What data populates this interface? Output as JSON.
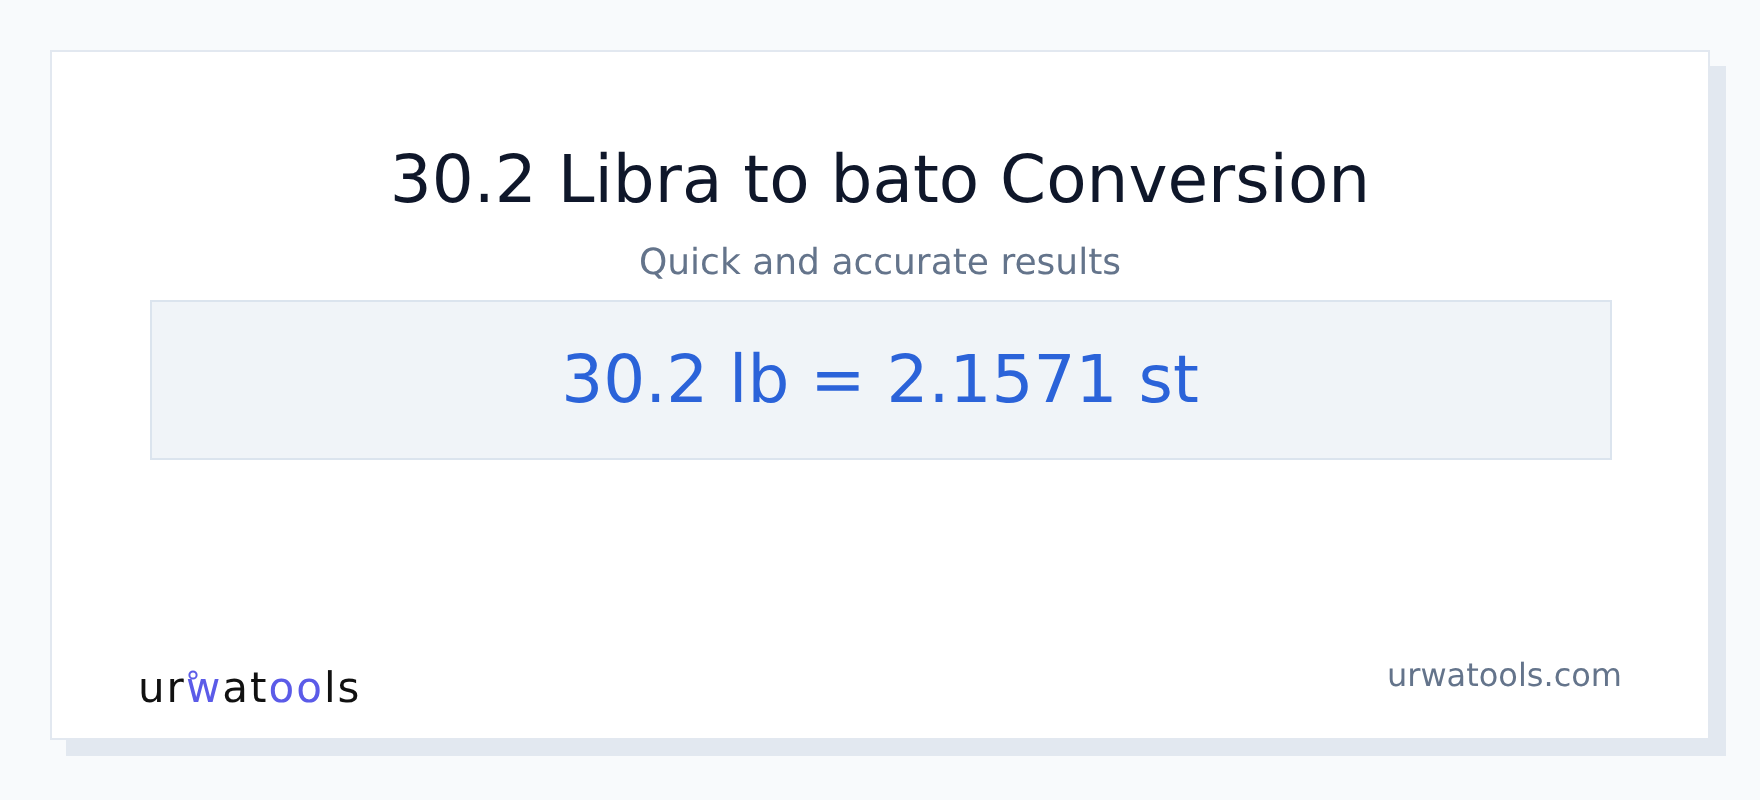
{
  "title": "30.2 Libra to bato Conversion",
  "subtitle": "Quick and accurate results",
  "result": "30.2 lb = 2.1571 st",
  "logo": {
    "parts": [
      {
        "text": "ur",
        "highlight": false
      },
      {
        "text": "w",
        "highlight": true
      },
      {
        "text": "at",
        "highlight": false
      },
      {
        "text": "oo",
        "highlight": true
      },
      {
        "text": "ls",
        "highlight": false
      }
    ]
  },
  "site": "urwatools.com"
}
